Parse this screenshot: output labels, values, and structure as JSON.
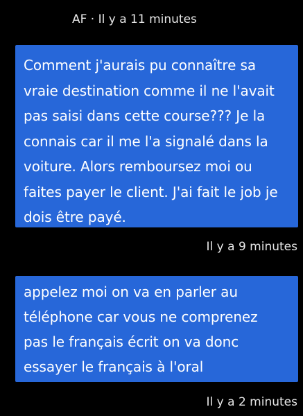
{
  "messages": [
    {
      "meta": "AF · Il y a 11 minutes",
      "lines": [
        "Comment j'aurais pu connaître sa",
        "vraie destination comme il ne l'avait",
        "pas saisi dans cette course??? Je la",
        "connais car il me l'a signalé dans la",
        "voiture. Alors remboursez moi ou",
        "faites payer le client. J'ai fait le job je",
        "dois être payé."
      ],
      "timestamp": "Il y a 9 minutes"
    },
    {
      "lines": [
        "appelez moi on va en parler au",
        "téléphone car vous ne comprenez",
        "pas le français écrit on va donc",
        "essayer le français à l'oral"
      ],
      "timestamp": "Il y a 2 minutes"
    }
  ],
  "colors": {
    "background": "#000000",
    "bubble": "#2767d9",
    "text": "#ffffff",
    "meta": "#e6e6e6"
  }
}
